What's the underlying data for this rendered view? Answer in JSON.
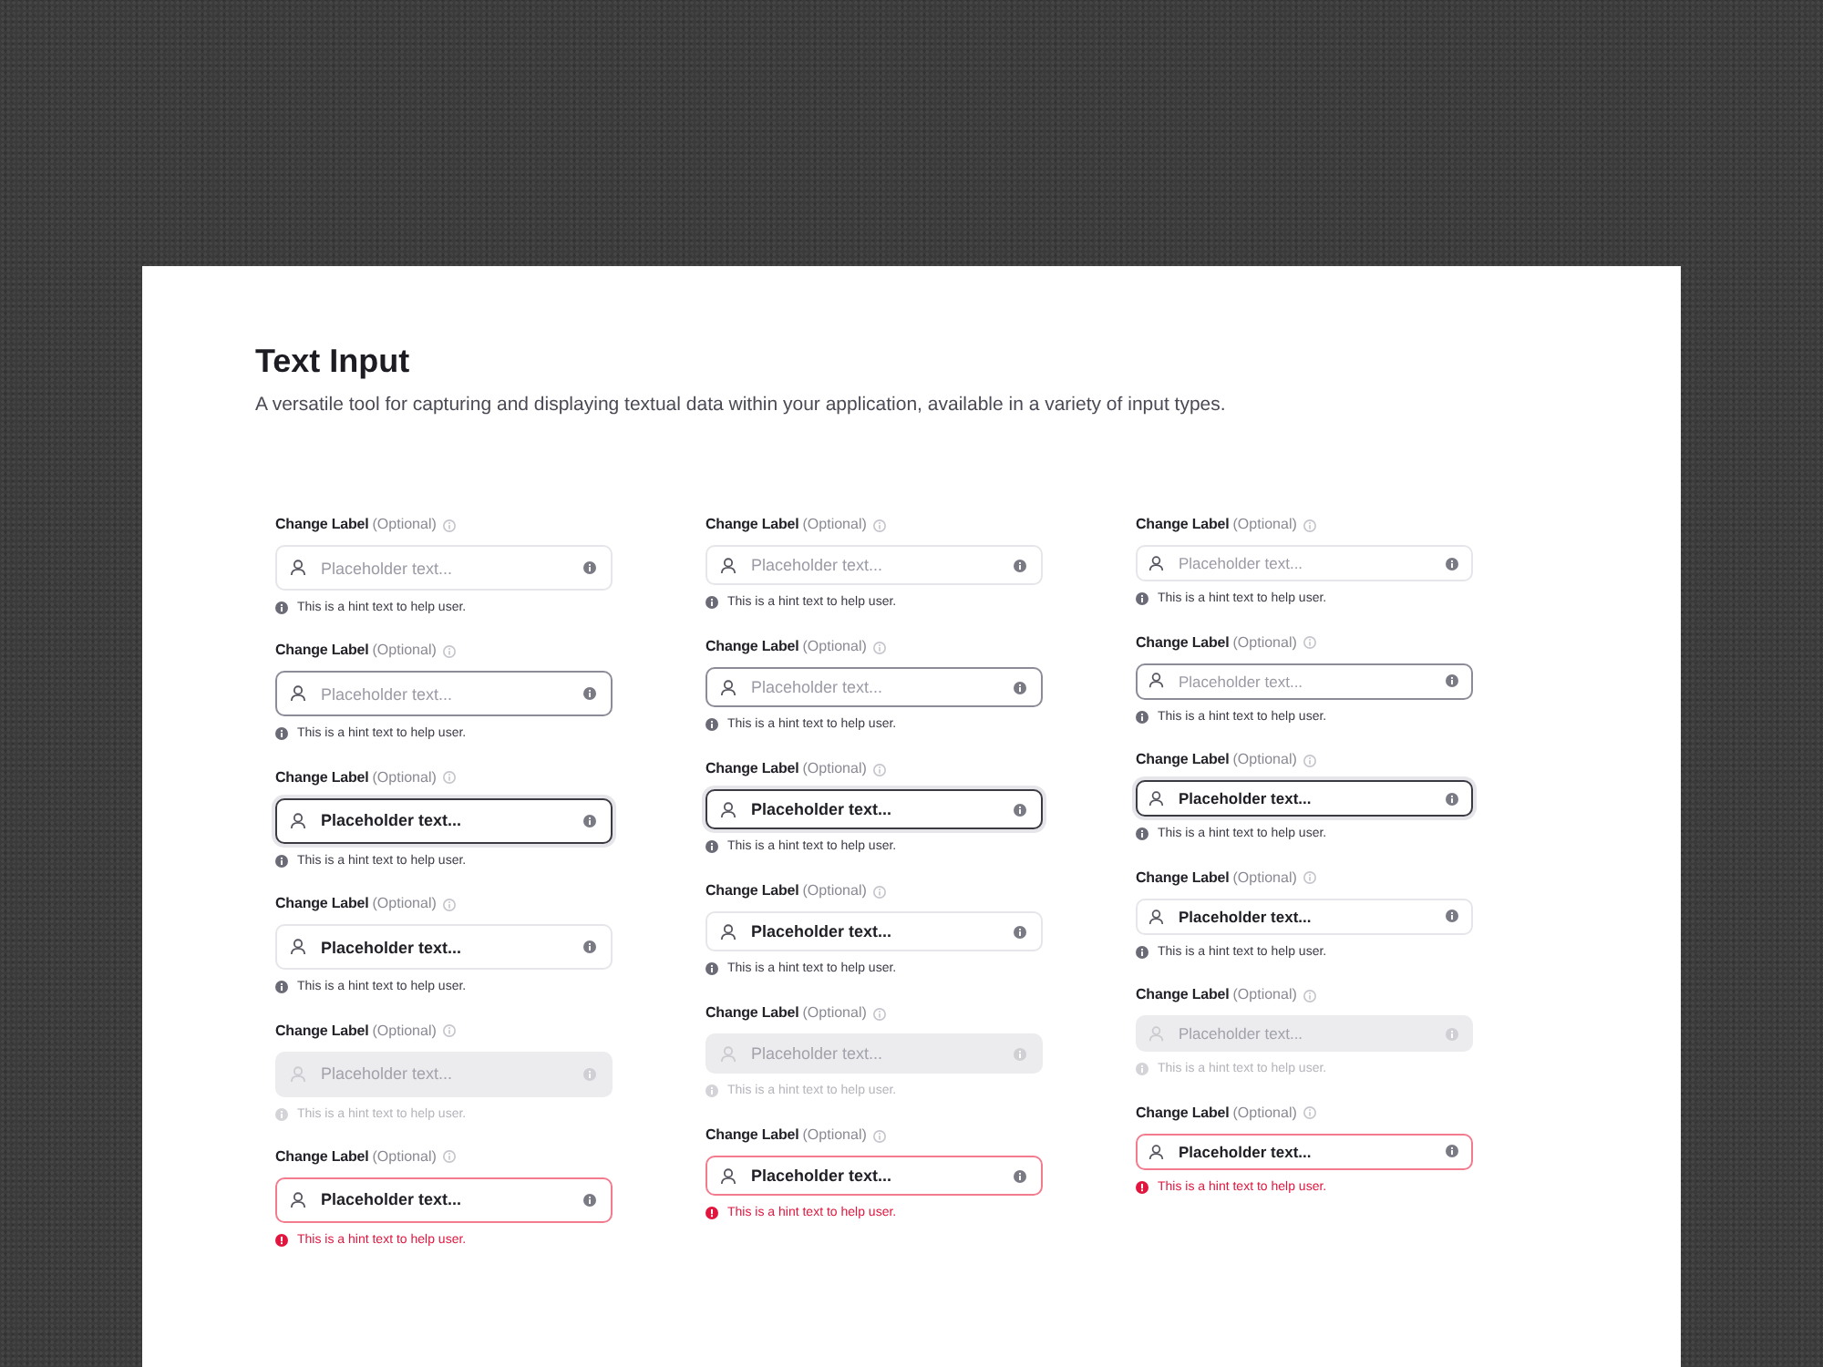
{
  "page": {
    "title": "Text Input",
    "description": "A versatile tool for capturing and displaying textual data within your application, available in a variety of input types."
  },
  "columns": [
    {
      "kind": "large",
      "fields": [
        {
          "label": "Change Label",
          "optional": "(Optional)",
          "hover": false,
          "focused": false,
          "disabled": false,
          "error": false,
          "placeholder": "Placeholder text...",
          "hint": "This is a hint text to help user."
        },
        {
          "label": "Change Label",
          "optional": "(Optional)",
          "hover": true,
          "focused": false,
          "disabled": false,
          "error": false,
          "placeholder": "Placeholder text...",
          "hint": "This is a hint text to help user."
        },
        {
          "label": "Change Label",
          "optional": "(Optional)",
          "hover": false,
          "focused": true,
          "disabled": false,
          "error": false,
          "value": "Placeholder text...",
          "hint": "This is a hint text to help user."
        },
        {
          "label": "Change Label",
          "optional": "(Optional)",
          "hover": false,
          "focused": false,
          "disabled": false,
          "error": false,
          "value": "Placeholder text...",
          "hint": "This is a hint text to help user."
        },
        {
          "label": "Change Label",
          "optional": "(Optional)",
          "hover": false,
          "focused": false,
          "disabled": true,
          "error": false,
          "placeholder": "Placeholder text...",
          "hint": "This is a hint text to help user."
        },
        {
          "label": "Change Label",
          "optional": "(Optional)",
          "hover": false,
          "focused": false,
          "disabled": false,
          "error": true,
          "value": "Placeholder text...",
          "hint": "This is a hint text to help user."
        }
      ]
    },
    {
      "kind": "medium",
      "fields": [
        {
          "label": "Change Label",
          "optional": "(Optional)",
          "hover": false,
          "focused": false,
          "disabled": false,
          "error": false,
          "placeholder": "Placeholder text...",
          "hint": "This is a hint text to help user."
        },
        {
          "label": "Change Label",
          "optional": "(Optional)",
          "hover": true,
          "focused": false,
          "disabled": false,
          "error": false,
          "placeholder": "Placeholder text...",
          "hint": "This is a hint text to help user."
        },
        {
          "label": "Change Label",
          "optional": "(Optional)",
          "hover": false,
          "focused": true,
          "disabled": false,
          "error": false,
          "value": "Placeholder text...",
          "hint": "This is a hint text to help user."
        },
        {
          "label": "Change Label",
          "optional": "(Optional)",
          "hover": false,
          "focused": false,
          "disabled": false,
          "error": false,
          "value": "Placeholder text...",
          "hint": "This is a hint text to help user."
        },
        {
          "label": "Change Label",
          "optional": "(Optional)",
          "hover": false,
          "focused": false,
          "disabled": true,
          "error": false,
          "placeholder": "Placeholder text...",
          "hint": "This is a hint text to help user."
        },
        {
          "label": "Change Label",
          "optional": "(Optional)",
          "hover": false,
          "focused": false,
          "disabled": false,
          "error": true,
          "value": "Placeholder text...",
          "hint": "This is a hint text to help user."
        }
      ]
    },
    {
      "kind": "small",
      "fields": [
        {
          "label": "Change Label",
          "optional": "(Optional)",
          "hover": false,
          "focused": false,
          "disabled": false,
          "error": false,
          "placeholder": "Placeholder text...",
          "hint": "This is a hint text to help user."
        },
        {
          "label": "Change Label",
          "optional": "(Optional)",
          "hover": true,
          "focused": false,
          "disabled": false,
          "error": false,
          "placeholder": "Placeholder text...",
          "hint": "This is a hint text to help user."
        },
        {
          "label": "Change Label",
          "optional": "(Optional)",
          "hover": false,
          "focused": true,
          "disabled": false,
          "error": false,
          "value": "Placeholder text...",
          "hint": "This is a hint text to help user."
        },
        {
          "label": "Change Label",
          "optional": "(Optional)",
          "hover": false,
          "focused": false,
          "disabled": false,
          "error": false,
          "value": "Placeholder text...",
          "hint": "This is a hint text to help user."
        },
        {
          "label": "Change Label",
          "optional": "(Optional)",
          "hover": false,
          "focused": false,
          "disabled": true,
          "error": false,
          "placeholder": "Placeholder text...",
          "hint": "This is a hint text to help user."
        },
        {
          "label": "Change Label",
          "optional": "(Optional)",
          "hover": false,
          "focused": false,
          "disabled": false,
          "error": true,
          "value": "Placeholder text...",
          "hint": "This is a hint text to help user."
        }
      ]
    }
  ]
}
